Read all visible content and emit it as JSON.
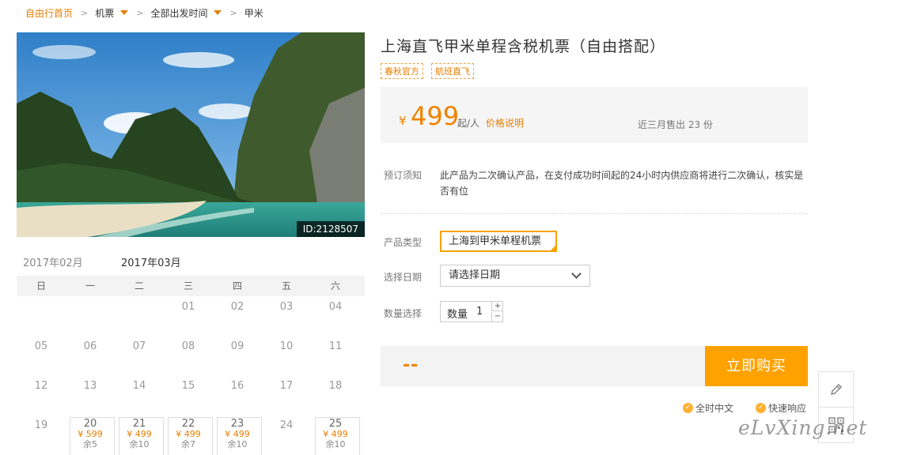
{
  "breadcrumb": {
    "home": "自由行首页",
    "sep": ">",
    "items": [
      {
        "label": "机票",
        "dropdown": true
      },
      {
        "label": "全部出发时间",
        "dropdown": true
      },
      {
        "label": "甲米",
        "dropdown": false
      }
    ]
  },
  "hero": {
    "id_label": "ID:2128507"
  },
  "calendar": {
    "months": [
      "2017年02月",
      "2017年03月"
    ],
    "active_month": 1,
    "weekdays": [
      "日",
      "一",
      "二",
      "三",
      "四",
      "五",
      "六"
    ],
    "rows": [
      [
        {
          "day": ""
        },
        {
          "day": ""
        },
        {
          "day": ""
        },
        {
          "day": "01"
        },
        {
          "day": "02"
        },
        {
          "day": "03"
        },
        {
          "day": "04"
        }
      ],
      [
        {
          "day": "05"
        },
        {
          "day": "06"
        },
        {
          "day": "07"
        },
        {
          "day": "08"
        },
        {
          "day": "09"
        },
        {
          "day": "10"
        },
        {
          "day": "11"
        }
      ],
      [
        {
          "day": "12"
        },
        {
          "day": "13"
        },
        {
          "day": "14"
        },
        {
          "day": "15"
        },
        {
          "day": "16"
        },
        {
          "day": "17"
        },
        {
          "day": "18"
        }
      ],
      [
        {
          "day": "19"
        },
        {
          "day": "20",
          "price": "¥ 599",
          "stock": "余5"
        },
        {
          "day": "21",
          "price": "¥ 499",
          "stock": "余10"
        },
        {
          "day": "22",
          "price": "¥ 499",
          "stock": "余7"
        },
        {
          "day": "23",
          "price": "¥ 499",
          "stock": "余10"
        },
        {
          "day": "24"
        },
        {
          "day": "25",
          "price": "¥ 499",
          "stock": "余10"
        }
      ]
    ]
  },
  "product": {
    "title": "上海直飞甲米单程含税机票（自由搭配）",
    "tags": [
      "春秋官方",
      "航班直飞"
    ],
    "price": {
      "currency": "¥",
      "amount": "499",
      "unit": "起/人",
      "explain_link": "价格说明",
      "sold": "近三月售出 23 份"
    },
    "notice_label": "预订须知",
    "notice_text": "此产品为二次确认产品，在支付成功时间起的24小时内供应商将进行二次确认，核实是否有位",
    "type_label": "产品类型",
    "type_value": "上海到甲米单程机票",
    "date_label": "选择日期",
    "date_placeholder": "请选择日期",
    "qty_label": "数量选择",
    "qty_field_label": "数量",
    "qty_value": "1",
    "qty_plus": "+",
    "qty_minus": "−"
  },
  "buy": {
    "total": "--",
    "button": "立即购买"
  },
  "promises": [
    "全时中文",
    "快速响应"
  ],
  "watermark": "eLvXing.net",
  "colors": {
    "accent": "#f08200",
    "button": "#ffa200",
    "home_link": "#e67e00"
  }
}
